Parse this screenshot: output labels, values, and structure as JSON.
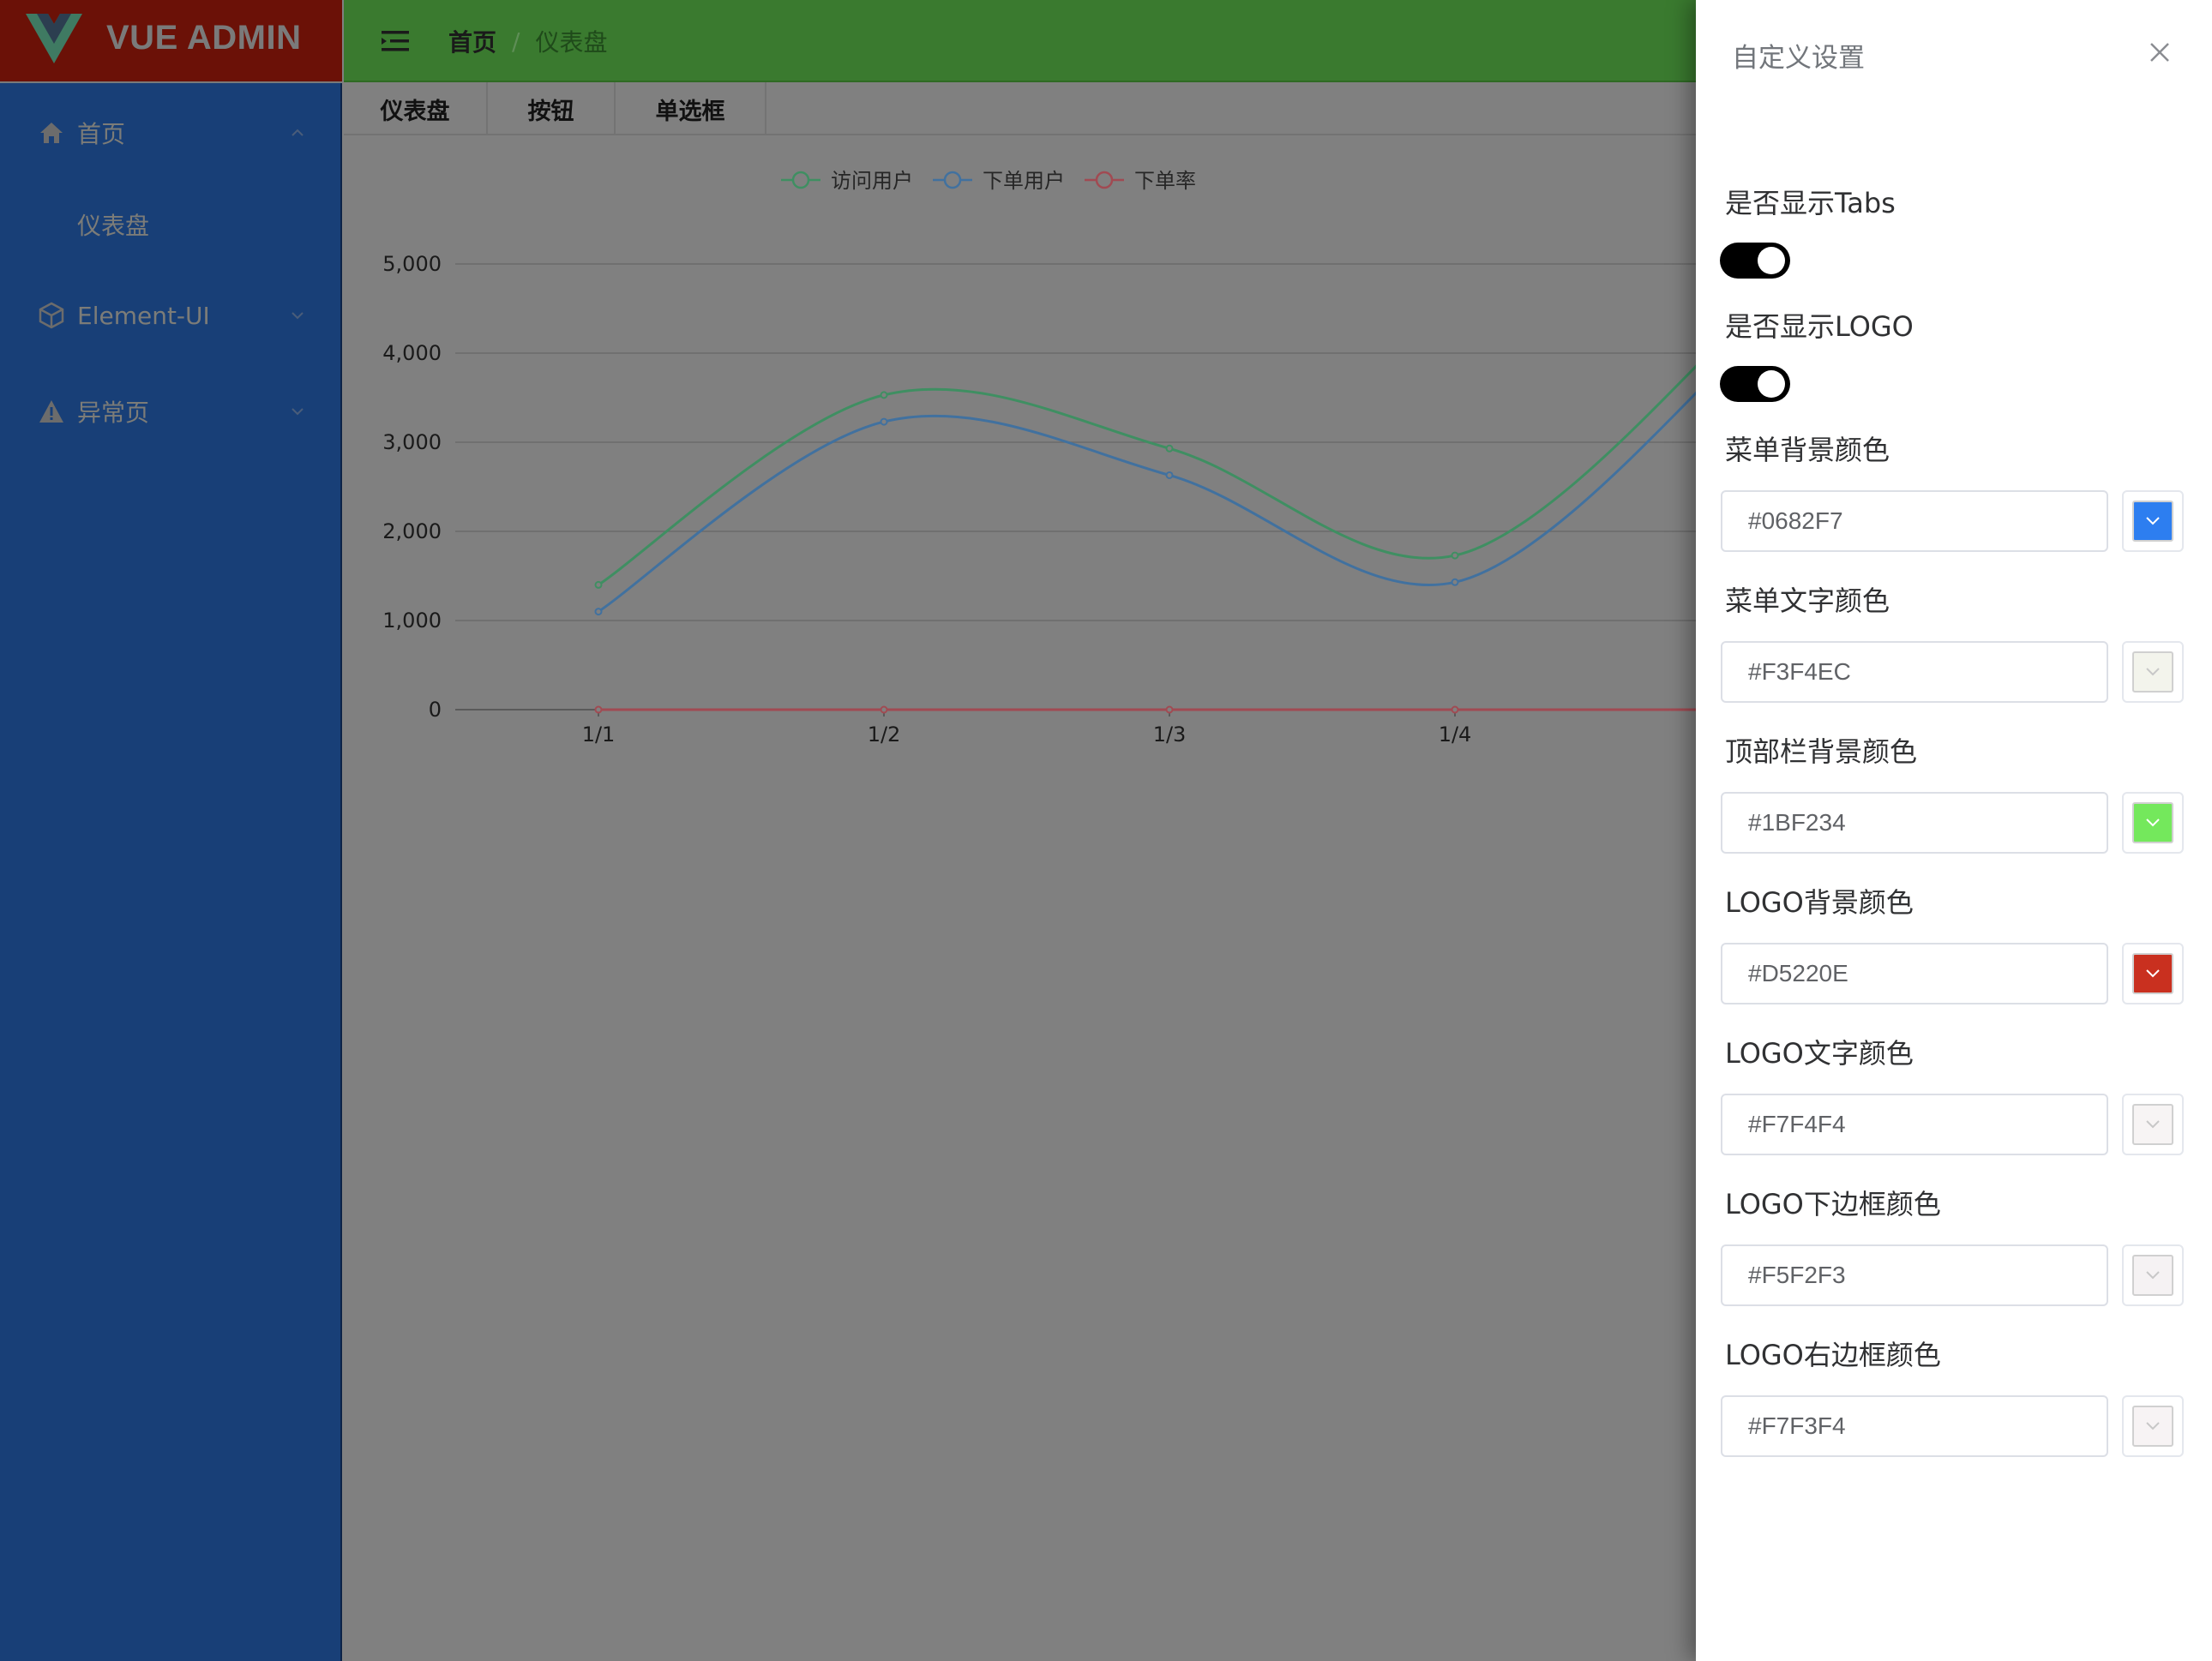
{
  "app": {
    "logo_text": "VUE ADMIN"
  },
  "sidebar": {
    "items": [
      {
        "label": "首页",
        "icon": "home-icon"
      },
      {
        "label": "仪表盘"
      },
      {
        "label": "Element-UI",
        "icon": "cube-icon"
      },
      {
        "label": "异常页",
        "icon": "warning-icon"
      }
    ]
  },
  "header": {
    "breadcrumb": {
      "home": "首页",
      "separator": "/",
      "current": "仪表盘"
    }
  },
  "tabs": [
    {
      "label": "仪表盘"
    },
    {
      "label": "按钮"
    },
    {
      "label": "单选框"
    }
  ],
  "chart_data": {
    "type": "line",
    "categories": [
      "1/1",
      "1/2",
      "1/3",
      "1/4"
    ],
    "series": [
      {
        "name": "访问用户",
        "color": "#3f8f62",
        "values": [
          1400,
          3530,
          2930,
          1730
        ]
      },
      {
        "name": "下单用户",
        "color": "#41719f",
        "values": [
          1100,
          3230,
          2630,
          1430
        ]
      },
      {
        "name": "下单率",
        "color": "#a14a52",
        "values": [
          0,
          0,
          0,
          0
        ]
      }
    ],
    "yticks": [
      "0",
      "1,000",
      "2,000",
      "3,000",
      "4,000",
      "5,000"
    ],
    "ylim": [
      0,
      5000
    ],
    "grid": true,
    "legend_position": "top"
  },
  "drawer": {
    "title": "自定义设置",
    "show_tabs_label": "是否显示Tabs",
    "show_tabs": true,
    "show_logo_label": "是否显示LOGO",
    "show_logo": true,
    "colors": [
      {
        "label": "菜单背景颜色",
        "value": "#0682F7",
        "swatch": "#2d7ef0"
      },
      {
        "label": "菜单文字颜色",
        "value": "#F3F4EC",
        "swatch": "#f3f4ec"
      },
      {
        "label": "顶部栏背景颜色",
        "value": "#1BF234",
        "swatch": "#74e85c"
      },
      {
        "label": "LOGO背景颜色",
        "value": "#D5220E",
        "swatch": "#c9301f"
      },
      {
        "label": "LOGO文字颜色",
        "value": "#F7F4F4",
        "swatch": "#f7f4f4"
      },
      {
        "label": "LOGO下边框颜色",
        "value": "#F5F2F3",
        "swatch": "#f5f2f3"
      },
      {
        "label": "LOGO右边框颜色",
        "value": "#F7F3F4",
        "swatch": "#f7f3f4"
      }
    ]
  }
}
